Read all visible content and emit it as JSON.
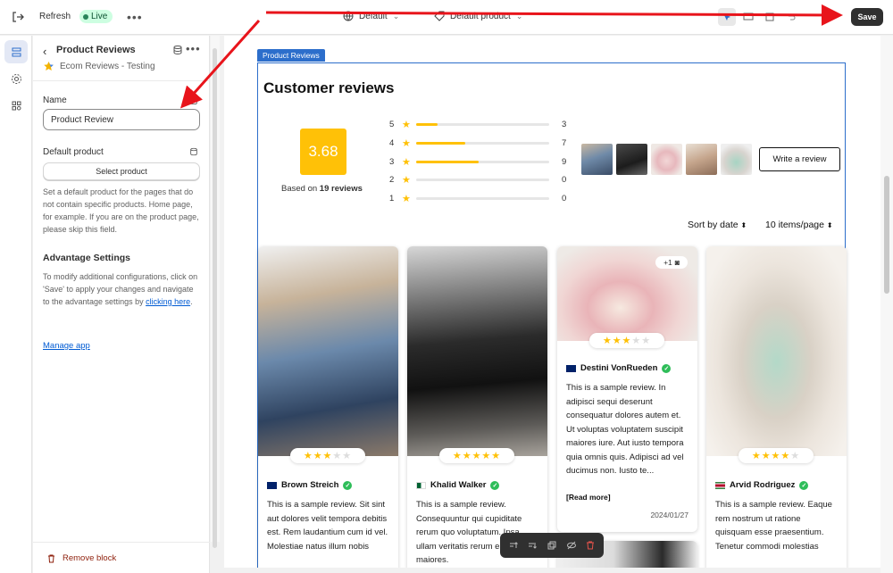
{
  "topbar": {
    "refresh_label": "Refresh",
    "live_label": "Live",
    "theme_label": "Default",
    "template_label": "Default product",
    "save_label": "Save"
  },
  "sidebar": {
    "title": "Product Reviews",
    "app_name": "Ecom Reviews - Testing",
    "name_label": "Name",
    "name_value": "Product Review",
    "default_product_label": "Default product",
    "select_product_label": "Select product",
    "default_product_help": "Set a default product for the pages that do not contain specific products. Home page, for example. If you are on the product page, please skip this field.",
    "advantage_heading": "Advantage Settings",
    "advantage_help": "To modify additional configurations, click on 'Save' to apply your changes and navigate to the advantage settings by",
    "advantage_link": "clicking here",
    "advantage_period": ".",
    "manage_app": "Manage app",
    "remove_block": "Remove block"
  },
  "preview": {
    "block_tag": "Product Reviews",
    "title": "Customer reviews",
    "score": "3.68",
    "based_on_prefix": "Based on",
    "based_on_count": "19 reviews",
    "distribution": [
      {
        "stars": "5",
        "count": "3",
        "fraction": 0.16
      },
      {
        "stars": "4",
        "count": "7",
        "fraction": 0.37
      },
      {
        "stars": "3",
        "count": "9",
        "fraction": 0.47
      },
      {
        "stars": "2",
        "count": "0",
        "fraction": 0
      },
      {
        "stars": "1",
        "count": "0",
        "fraction": 0
      }
    ],
    "write_review": "Write a review",
    "sort_label": "Sort by date",
    "items_label": "10 items/page",
    "cards": [
      {
        "author": "Brown Streich",
        "rating": 3,
        "body": "This is a sample review. Sit sint aut dolores velit tempora debitis est. Rem laudantium cum id vel. Molestiae natus illum nobis"
      },
      {
        "author": "Khalid Walker",
        "rating": 5,
        "body": "This is a sample review. Consequuntur qui cupiditate rerum quo voluptatum. Ipsa ullam veritatis rerum ea maiores."
      },
      {
        "author": "Destini VonRueden",
        "rating": 3,
        "more_photos": "+1",
        "body": "This is a sample review. In adipisci sequi deserunt consequatur dolores autem et. Ut voluptas voluptatem suscipit maiores iure. Aut iusto tempora quia omnis quis. Adipisci ad vel ducimus non. Iusto te...",
        "read_more": "[Read more]",
        "date": "2024/01/27"
      },
      {
        "author": "Arvid Rodriguez",
        "rating": 4,
        "body": "This is a sample review. Eaque rem nostrum ut ratione quisquam esse praesentium. Tenetur commodi molestias"
      }
    ]
  },
  "colors": {
    "accent": "#2c6ecb",
    "star": "#ffc107",
    "save_bg": "#303030",
    "live_bg": "#cdfee1",
    "arrow": "#e8141b"
  }
}
